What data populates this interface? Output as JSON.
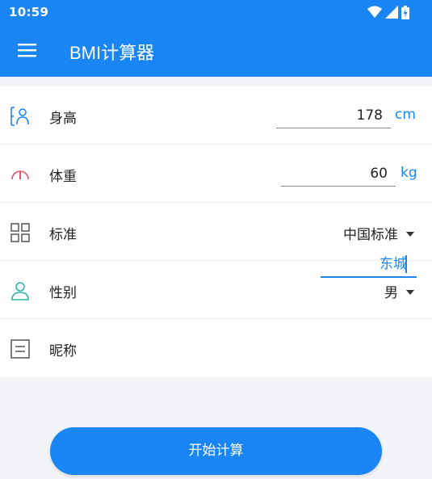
{
  "status_bar": {
    "time": "10:59"
  },
  "toolbar": {
    "title": "BMI计算器"
  },
  "form": {
    "height": {
      "label": "身高",
      "value": "178",
      "unit": "cm"
    },
    "weight": {
      "label": "体重",
      "value": "60",
      "unit": "kg"
    },
    "standard": {
      "label": "标准",
      "selected": "中国标准"
    },
    "gender": {
      "label": "性别",
      "selected": "男"
    },
    "nickname": {
      "label": "昵称",
      "value": "东城"
    }
  },
  "actions": {
    "calculate_label": "开始计算"
  },
  "colors": {
    "primary": "#1a86f5",
    "weight_icon": "#e0566b",
    "gender_icon": "#2bb5a6",
    "background": "#f3f4f7"
  },
  "icons": {
    "height": "height-person-icon",
    "weight": "gauge-icon",
    "standard": "grid-icon",
    "gender": "person-icon",
    "nickname": "document-icon"
  }
}
